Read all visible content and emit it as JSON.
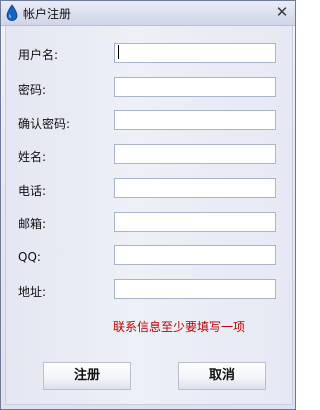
{
  "window": {
    "title": "帐户注册",
    "icon": "water-drop-icon",
    "close_glyph": "✕"
  },
  "form": {
    "fields": [
      {
        "label": "用户名:",
        "value": ""
      },
      {
        "label": "密码:",
        "value": ""
      },
      {
        "label": "确认密码:",
        "value": ""
      },
      {
        "label": "姓名:",
        "value": ""
      },
      {
        "label": "电话:",
        "value": ""
      },
      {
        "label": "邮箱:",
        "value": ""
      },
      {
        "label": "QQ:",
        "value": ""
      },
      {
        "label": "地址:",
        "value": ""
      }
    ],
    "notice": "联系信息至少要填写一项"
  },
  "buttons": {
    "register": "注册",
    "cancel": "取消"
  },
  "colors": {
    "notice": "#c00000",
    "icon": "#1565c0"
  }
}
